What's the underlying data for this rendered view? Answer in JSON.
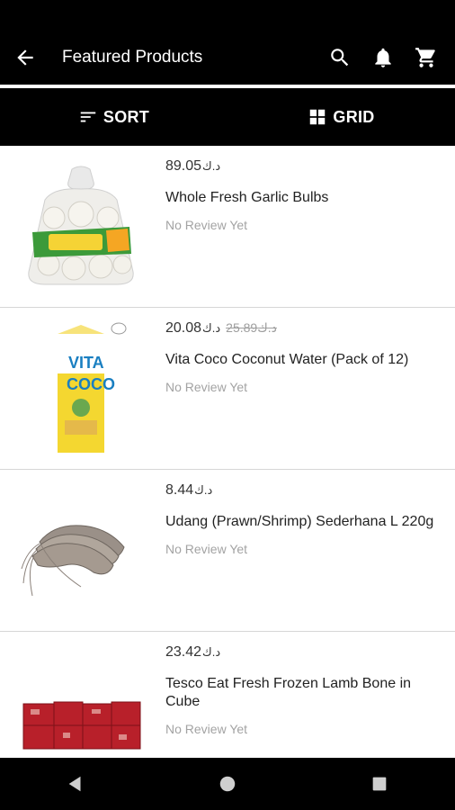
{
  "app_bar": {
    "title": "Featured Products",
    "icons": [
      "back-arrow-icon",
      "search-icon",
      "bell-icon",
      "cart-icon"
    ]
  },
  "toolbar": {
    "sort_label": "SORT",
    "grid_label": "GRID"
  },
  "products": [
    {
      "price": "89.05",
      "currency": "د.ك",
      "old_price": "",
      "old_currency": "",
      "name": "Whole Fresh Garlic Bulbs",
      "review": "No Review Yet"
    },
    {
      "price": "20.08",
      "currency": "د.ك",
      "old_price": "25.89",
      "old_currency": "د.ك",
      "name": "Vita Coco Coconut Water (Pack of 12)",
      "review": "No Review Yet"
    },
    {
      "price": "8.44",
      "currency": "د.ك",
      "old_price": "",
      "old_currency": "",
      "name": "Udang (Prawn/Shrimp) Sederhana L 220g",
      "review": "No Review Yet"
    },
    {
      "price": "23.42",
      "currency": "د.ك",
      "old_price": "",
      "old_currency": "",
      "name": "Tesco Eat Fresh Frozen Lamb Bone in Cube",
      "review": "No Review Yet"
    }
  ],
  "nav_bar": {
    "icons": [
      "back-triangle-icon",
      "home-circle-icon",
      "recents-square-icon"
    ]
  }
}
